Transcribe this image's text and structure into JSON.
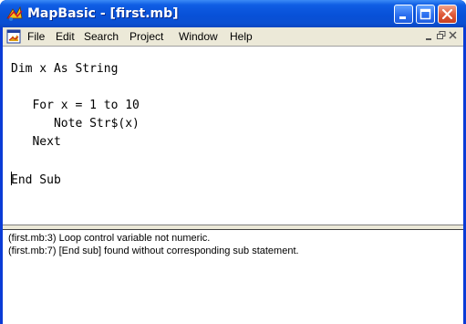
{
  "window": {
    "title": "MapBasic - [first.mb]"
  },
  "menubar": {
    "items": [
      "File",
      "Edit",
      "Search",
      "Project",
      "Window",
      "Help"
    ]
  },
  "editor": {
    "lines": [
      "Dim x As String",
      "",
      "   For x = 1 to 10",
      "      Note Str$(x)",
      "   Next",
      "",
      "End Sub"
    ]
  },
  "messages": [
    "(first.mb:3) Loop control variable not numeric.",
    "(first.mb:7) [End sub] found without corresponding sub statement."
  ],
  "icons": {
    "app": "mapbasic-app-icon",
    "doc": "mapbasic-doc-icon",
    "minimize": "minimize-icon",
    "maximize": "maximize-icon",
    "close": "close-icon",
    "mdi_restore": "restore-icon",
    "mdi_close": "close-icon"
  },
  "colors": {
    "titlebar": "#0a4fd2",
    "close": "#e05c3c",
    "editor_bg": "#ffffff",
    "menubar_bg": "#ece9d8"
  }
}
